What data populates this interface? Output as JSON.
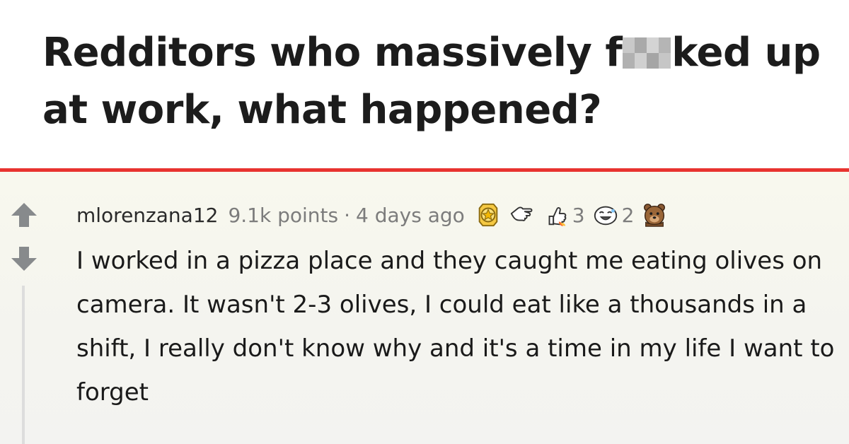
{
  "post": {
    "title_part1": "Redditors who massively f",
    "title_part2": "ked up at work, what happened?"
  },
  "comment": {
    "author": "mlorenzana12",
    "points": "9.1k points",
    "separator": "·",
    "time": "4 days ago",
    "awards": [
      {
        "icon": "gold-medal-icon",
        "count": ""
      },
      {
        "icon": "pointing-hand-icon",
        "count": ""
      },
      {
        "icon": "rocket-thumbs-up-icon",
        "count": "3"
      },
      {
        "icon": "laughing-face-icon",
        "count": "2"
      },
      {
        "icon": "bear-face-icon",
        "count": ""
      }
    ],
    "body": "I worked in a pizza place and they caught me eating olives on camera. It wasn't 2-3 olives, I could eat like a thousands in a shift, I really don't know why and it's a time in my life I want to forget"
  },
  "colors": {
    "accent_divider": "#e8332f",
    "vote_arrow": "#878a8c",
    "title_text": "#1c1c1c",
    "meta_text": "#7c7c7c"
  }
}
